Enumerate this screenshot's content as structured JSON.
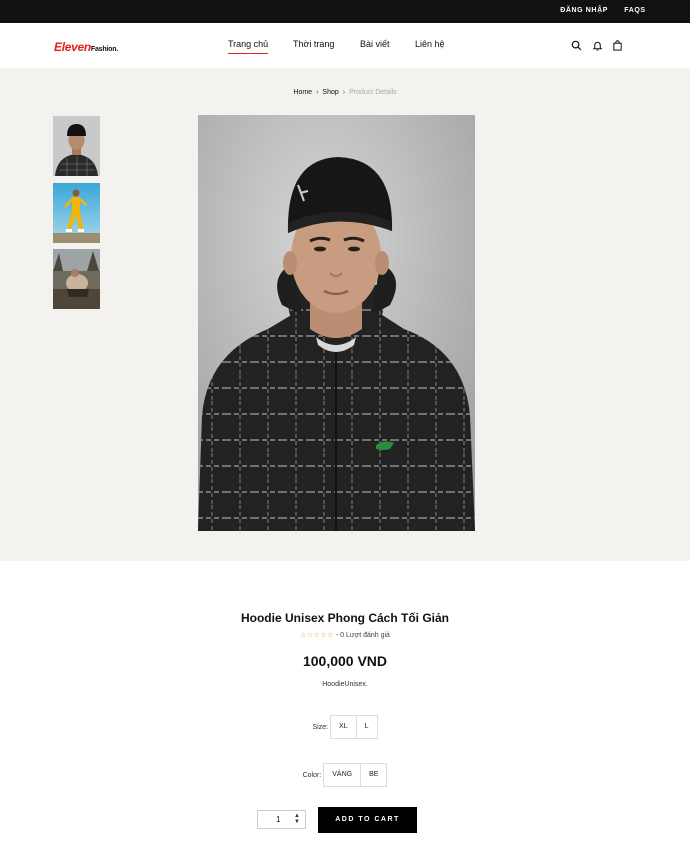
{
  "topbar": {
    "login": "ĐĂNG NHẬP",
    "faqs": "FAQS"
  },
  "logo": {
    "brand": "Eleven",
    "sub": "Fashion."
  },
  "nav": {
    "items": [
      "Trang chủ",
      "Thời trang",
      "Bài viết",
      "Liên hệ"
    ],
    "active": "Trang chủ"
  },
  "header_icons": [
    "search-icon",
    "bell-icon",
    "bag-icon"
  ],
  "breadcrumb": {
    "home": "Home",
    "shop": "Shop",
    "current": "Product Details"
  },
  "product": {
    "title": "Hoodie Unisex Phong Cách Tối Giản",
    "rating_stars": "☆☆☆☆☆",
    "rating_text": "- 0 Lượt đánh giá",
    "price": "100,000 VND",
    "description": "HoodieUnisex."
  },
  "options": {
    "size_label": "Size:",
    "sizes": [
      "XL",
      "L"
    ],
    "color_label": "Color:",
    "colors": [
      "VÀNG",
      "BE"
    ]
  },
  "quantity": "1",
  "cart_label": "ADD TO CART",
  "colors": {
    "accent": "#e0241f",
    "topbar": "#111111",
    "gallery_bg": "#f3f2ee",
    "button": "#000000"
  }
}
